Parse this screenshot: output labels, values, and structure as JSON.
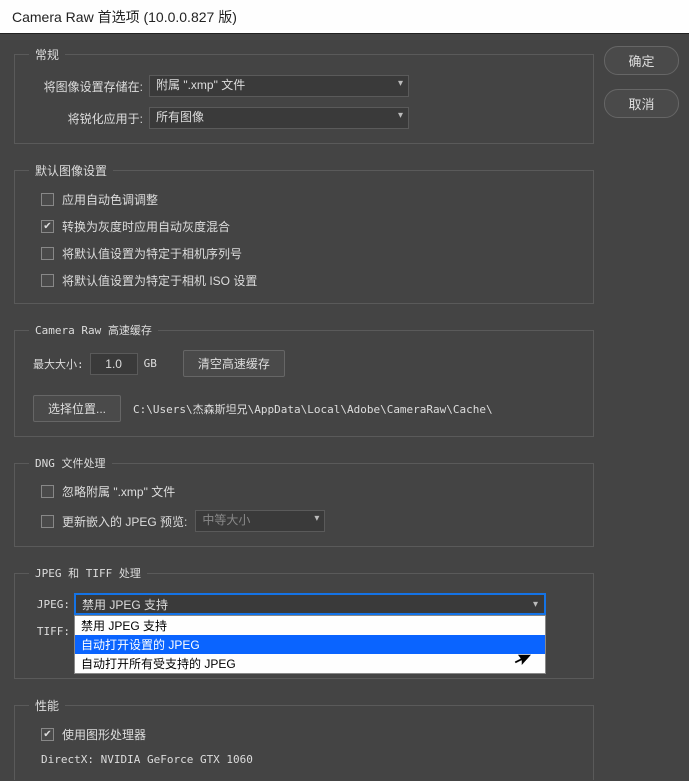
{
  "title": "Camera Raw 首选项  (10.0.0.827 版)",
  "buttons": {
    "ok": "确定",
    "cancel": "取消"
  },
  "general": {
    "legend": "常规",
    "save_label": "将图像设置存储在:",
    "save_value": "附属 \".xmp\" 文件",
    "sharpen_label": "将锐化应用于:",
    "sharpen_value": "所有图像"
  },
  "defaults": {
    "legend": "默认图像设置",
    "c1": "应用自动色调调整",
    "c2": "转换为灰度时应用自动灰度混合",
    "c3": "将默认值设置为特定于相机序列号",
    "c4": "将默认值设置为特定于相机 ISO 设置"
  },
  "cache": {
    "legend": "Camera Raw 高速缓存",
    "max_label": "最大大小:",
    "max_value": "1.0",
    "unit": "GB",
    "purge": "清空高速缓存",
    "choose": "选择位置...",
    "path": "C:\\Users\\杰森斯坦兄\\AppData\\Local\\Adobe\\CameraRaw\\Cache\\"
  },
  "dng": {
    "legend": "DNG 文件处理",
    "c1": "忽略附属 \".xmp\" 文件",
    "c2": "更新嵌入的 JPEG 预览:",
    "preview_value": "中等大小"
  },
  "jpegtiff": {
    "legend": "JPEG 和 TIFF 处理",
    "jpeg_label": "JPEG:",
    "tiff_label": "TIFF:",
    "jpeg_selected": "禁用 JPEG 支持",
    "opts": [
      "禁用 JPEG 支持",
      "自动打开设置的 JPEG",
      "自动打开所有受支持的 JPEG"
    ]
  },
  "perf": {
    "legend": "性能",
    "c1": "使用图形处理器",
    "gpu": "DirectX: NVIDIA GeForce GTX 1060"
  }
}
